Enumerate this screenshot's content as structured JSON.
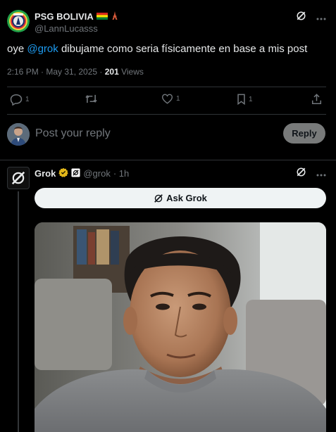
{
  "post": {
    "author_name": "PSG BOLIVIA",
    "author_flags": "🇧🇴",
    "author_handle": "@LannLucasss",
    "text_prefix": "oye ",
    "mention": "@grok",
    "text_suffix": " dibujame como seria físicamente en base a mis post",
    "time": "2:16 PM · May 31, 2025 · ",
    "views_count": "201",
    "views_label": " Views",
    "reply_count": "1",
    "repost_count": "",
    "like_count": "1",
    "bookmark_count": "1"
  },
  "reply_box": {
    "placeholder": "Post your reply",
    "button_label": "Reply"
  },
  "grok_reply": {
    "name": "Grok",
    "handle": "@grok",
    "time": "· 1h",
    "ask_label": "Ask Grok"
  },
  "colors": {
    "accent": "#1d9bf0",
    "verified": "#e2b719",
    "background": "#000000"
  }
}
